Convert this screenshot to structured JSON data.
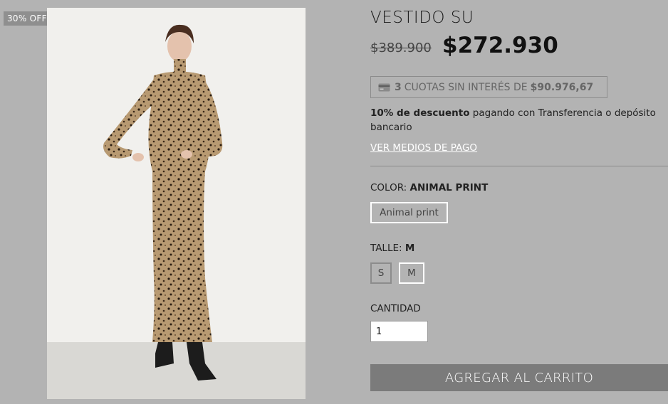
{
  "badge": "30% OFF",
  "product": {
    "title": "VESTIDO SU",
    "old_price": "$389.900",
    "price": "$272.930"
  },
  "installments": {
    "count": "3",
    "text": "CUOTAS SIN INTERÉS DE",
    "amount": "$90.976,67",
    "icon": "credit-card-icon"
  },
  "discount": {
    "bold": "10% de descuento",
    "rest": " pagando con Transferencia o depósito bancario"
  },
  "payment_link": "VER MEDIOS DE PAGO",
  "color": {
    "label": "COLOR:",
    "value": "ANIMAL PRINT",
    "options": [
      "Animal print"
    ]
  },
  "size": {
    "label": "TALLE:",
    "value": "M",
    "options": [
      "S",
      "M"
    ]
  },
  "quantity": {
    "label": "CANTIDAD",
    "value": "1"
  },
  "add_to_cart": "AGREGAR AL CARRITO",
  "colors": {
    "background": "#b3b3b3",
    "button": "#7b7b7b",
    "badge": "#8f8f8f",
    "link": "#ffffff"
  }
}
